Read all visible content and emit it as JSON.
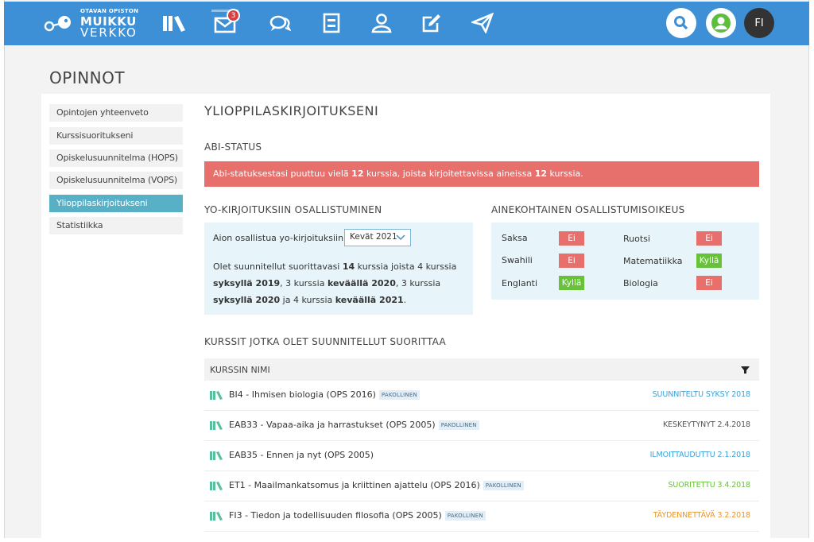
{
  "app": {
    "logo_top": "OTAVAN OPISTON",
    "logo_main": "MUIKKU",
    "logo_sub": "VERKKO",
    "nav_icons": [
      "books-icon",
      "mail-icon",
      "chat-icon",
      "notebook-icon",
      "user-group-icon",
      "edit-icon",
      "send-icon"
    ],
    "messages_badge": "3",
    "language": "FI",
    "colors": {
      "topbar": "#3d8fd6",
      "active_side": "#58b0c7",
      "alert": "#e8706c",
      "yes": "#67c23a",
      "no": "#e8706c",
      "info_box": "#e7f5fa"
    }
  },
  "page": {
    "title": "OPINNOT"
  },
  "sidebar": {
    "items": [
      {
        "label": "Opintojen yhteenveto"
      },
      {
        "label": "Kurssisuoritukseni"
      },
      {
        "label": "Opiskelusuunnitelma (HOPS)"
      },
      {
        "label": "Opiskelusuunnitelma (VOPS)"
      },
      {
        "label": "Ylioppilaskirjoitukseni",
        "active": true
      },
      {
        "label": "Statistiikka"
      }
    ]
  },
  "main": {
    "heading": "YLIOPPILASKIRJOITUKSENI",
    "abi_status": {
      "heading": "ABI-STATUS",
      "alert_pre": "Abi-statuksestasi puuttuu vielä ",
      "alert_num1": "12",
      "alert_mid": " kurssia, joista kirjoitettavissa aineissa ",
      "alert_num2": "12",
      "alert_post": " kurssia."
    },
    "participation": {
      "heading": "YO-KIRJOITUKSIIN OSALLISTUMINEN",
      "label": "Aion osallistua yo-kirjoituksiin",
      "selected": "Kevät 2021",
      "plan_p1": "Olet suunnitellut suorittavasi ",
      "plan_b1": "14",
      "plan_p2": " kurssia joista 4 kurssia ",
      "plan_b2": "syksyllä 2019",
      "plan_p3": ", 3 kurssia ",
      "plan_b3": "keväällä 2020",
      "plan_p4": ", 3 kurssia ",
      "plan_b4": "syksyllä 2020",
      "plan_p5": " ja 4 kurssia ",
      "plan_b5": "keväällä 2021",
      "plan_p6": "."
    },
    "eligibility": {
      "heading": "AINEKOHTAINEN OSALLISTUMISOIKEUS",
      "subjects": [
        {
          "name": "Saksa",
          "value": "Ei",
          "ok": false
        },
        {
          "name": "Swahili",
          "value": "Ei",
          "ok": false
        },
        {
          "name": "Englanti",
          "value": "Kyllä",
          "ok": true
        },
        {
          "name": "Ruotsi",
          "value": "Ei",
          "ok": false
        },
        {
          "name": "Matematiikka",
          "value": "Kyllä",
          "ok": true
        },
        {
          "name": "Biologia",
          "value": "Ei",
          "ok": false
        }
      ]
    },
    "courses": {
      "heading": "KURSSIT JOTKA OLET SUUNNITELLUT SUORITTAA",
      "column": "KURSSIN NIMI",
      "rows": [
        {
          "name": "BI4 - Ihmisen biologia (OPS 2016)",
          "tag": "PAKOLLINEN",
          "status": "SUUNNITELTU SYKSY 2018",
          "color": "#3aa0d8"
        },
        {
          "name": "EAB33 - Vapaa-aika ja harrastukset (OPS 2005)",
          "tag": "PAKOLLINEN",
          "status": "KESKEYTYNYT 2.4.2018",
          "color": "#555555"
        },
        {
          "name": "EAB35 - Ennen ja nyt (OPS 2005)",
          "tag": "",
          "status": "ILMOITTAUDUTTU 2.1.2018",
          "color": "#3aa0d8"
        },
        {
          "name": "ET1 - Maailmankatsomus ja kriittinen ajattelu (OPS 2016)",
          "tag": "PAKOLLINEN",
          "status": "SUORITETTU 3.4.2018",
          "color": "#67c23a"
        },
        {
          "name": "FI3 - Tiedon ja todellisuuden filosofia (OPS 2005)",
          "tag": "PAKOLLINEN",
          "status": "TÄYDENNETTÄVÄ 3.2.2018",
          "color": "#e5962f"
        }
      ]
    }
  }
}
